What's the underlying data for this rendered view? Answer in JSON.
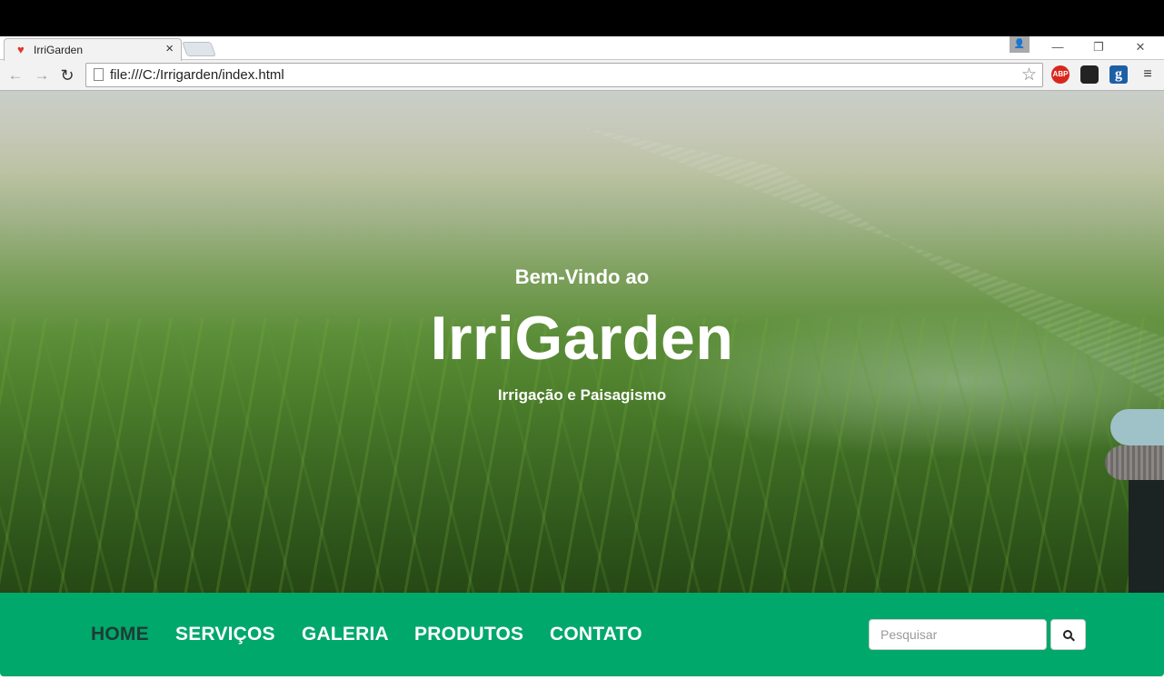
{
  "browser": {
    "tab": {
      "title": "IrriGarden",
      "favicon": "heart-icon"
    },
    "address_bar": {
      "url": "file:///C:/Irrigarden/index.html"
    },
    "extensions": [
      {
        "name": "adblock-plus-icon",
        "label": "ABP"
      },
      {
        "name": "ghostery-icon",
        "label": ""
      },
      {
        "name": "google-translate-icon",
        "label": "g"
      }
    ],
    "window_controls": {
      "minimize": "—",
      "restore": "❐",
      "close": "✕"
    }
  },
  "hero": {
    "welcome": "Bem-Vindo ao",
    "brand": "IrriGarden",
    "tagline": "Irrigação e Paisagismo"
  },
  "nav": {
    "items": [
      {
        "label": "HOME",
        "active": true
      },
      {
        "label": "SERVIÇOS",
        "active": false
      },
      {
        "label": "GALERIA",
        "active": false
      },
      {
        "label": "PRODUTOS",
        "active": false
      },
      {
        "label": "CONTATO",
        "active": false
      }
    ],
    "search": {
      "placeholder": "Pesquisar",
      "button_icon": "search-icon"
    },
    "colors": {
      "background": "#00a86b",
      "active_text": "#1f3b36",
      "text": "#ffffff"
    }
  }
}
